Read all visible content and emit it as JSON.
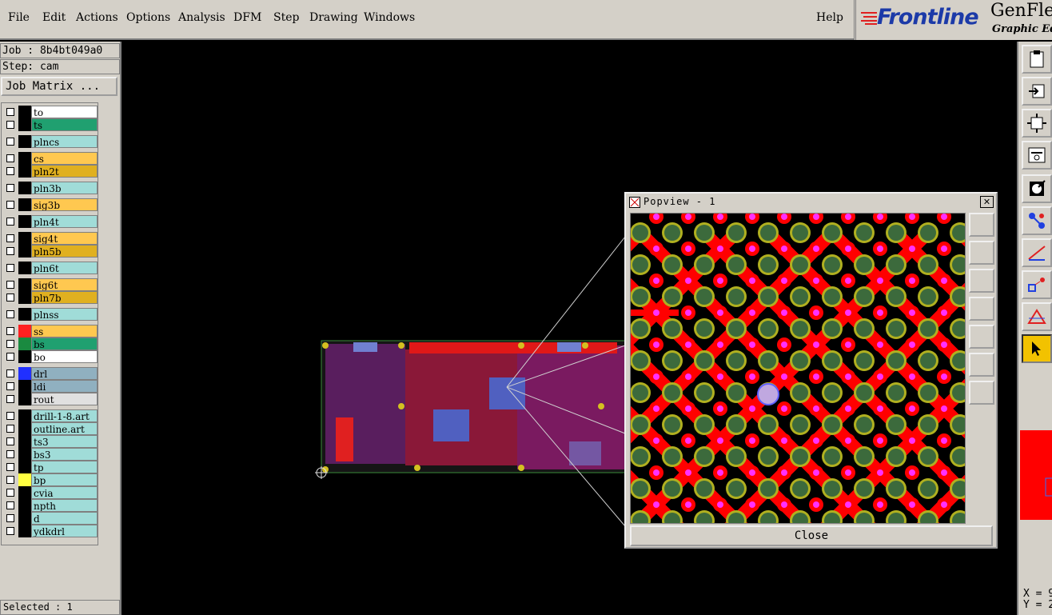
{
  "menu": {
    "file": "File",
    "edit": "Edit",
    "actions": "Actions",
    "options": "Options",
    "analysis": "Analysis",
    "dfm": "DFM",
    "step": "Step",
    "drawing": "Drawing",
    "windows": "Windows",
    "help": "Help"
  },
  "logo": {
    "brand": "Frontline",
    "product": "GenFle",
    "subtitle": "Graphic Edit"
  },
  "left_panel": {
    "job": "Job : 8b4bt049a0",
    "step": "Step: cam",
    "job_matrix_label": "Job Matrix ...",
    "selected": "Selected : 1"
  },
  "layers": [
    {
      "name": "to",
      "color": "#ffffff",
      "swatch": "#000000"
    },
    {
      "name": "ts",
      "color": "#20a070",
      "swatch": "#000000"
    },
    {
      "name": "plncs",
      "color": "#a0dcd8",
      "swatch": "#000000"
    },
    {
      "name": "cs",
      "color": "#ffc850",
      "swatch": "#000000"
    },
    {
      "name": "pln2t",
      "color": "#e0b020",
      "swatch": "#000000"
    },
    {
      "name": "pln3b",
      "color": "#a0dcd8",
      "swatch": "#000000"
    },
    {
      "name": "sig3b",
      "color": "#ffc850",
      "swatch": "#000000"
    },
    {
      "name": "pln4t",
      "color": "#a0dcd8",
      "swatch": "#000000"
    },
    {
      "name": "sig4t",
      "color": "#ffc850",
      "swatch": "#000000"
    },
    {
      "name": "pln5b",
      "color": "#e0b020",
      "swatch": "#000000"
    },
    {
      "name": "pln6t",
      "color": "#a0dcd8",
      "swatch": "#000000"
    },
    {
      "name": "sig6t",
      "color": "#ffc850",
      "swatch": "#000000"
    },
    {
      "name": "pln7b",
      "color": "#e0b020",
      "swatch": "#000000"
    },
    {
      "name": "plnss",
      "color": "#a0dcd8",
      "swatch": "#000000"
    },
    {
      "name": "ss",
      "color": "#ffc850",
      "swatch": "#ff2020"
    },
    {
      "name": "bs",
      "color": "#20a070",
      "swatch": "#1a8a40"
    },
    {
      "name": "bo",
      "color": "#ffffff",
      "swatch": "#000000"
    },
    {
      "name": "drl",
      "color": "#90b0c0",
      "swatch": "#2030ff"
    },
    {
      "name": "ldi",
      "color": "#90b0c0",
      "swatch": "#000000"
    },
    {
      "name": "rout",
      "color": "#e0e0e0",
      "swatch": "#000000"
    },
    {
      "name": "drill-1-8.art",
      "color": "#a0dcd8",
      "swatch": "#000000"
    },
    {
      "name": "outline.art",
      "color": "#a0dcd8",
      "swatch": "#000000"
    },
    {
      "name": "ts3",
      "color": "#a0dcd8",
      "swatch": "#000000"
    },
    {
      "name": "bs3",
      "color": "#a0dcd8",
      "swatch": "#000000"
    },
    {
      "name": "tp",
      "color": "#a0dcd8",
      "swatch": "#000000"
    },
    {
      "name": "bp",
      "color": "#a0dcd8",
      "swatch": "#ffff40"
    },
    {
      "name": "cvia",
      "color": "#a0dcd8",
      "swatch": "#000000"
    },
    {
      "name": "npth",
      "color": "#a0dcd8",
      "swatch": "#000000"
    },
    {
      "name": "d",
      "color": "#a0dcd8",
      "swatch": "#000000"
    },
    {
      "name": "ydkdrl",
      "color": "#a0dcd8",
      "swatch": "#000000"
    }
  ],
  "popview": {
    "title": "Popview - 1",
    "close_x": "✕",
    "close_label": "Close"
  },
  "coords": {
    "x": "X = 9",
    "y": "Y = 2"
  }
}
